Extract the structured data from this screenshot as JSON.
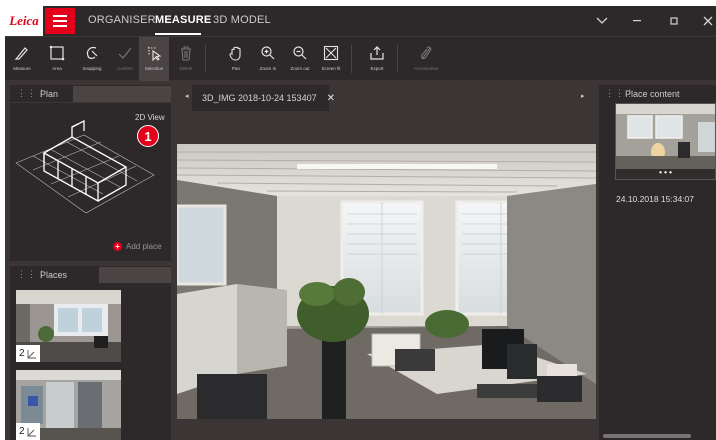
{
  "titlebar": {
    "logo_text": "Leica",
    "menu_icon": "hamburger-icon",
    "tabs": [
      {
        "label": "ORGANISER",
        "active": false
      },
      {
        "label": "MEASURE",
        "active": true
      },
      {
        "label": "3D MODEL",
        "active": false
      }
    ],
    "window_controls": [
      "chevron-down-icon",
      "minimize-icon",
      "restore-icon",
      "close-icon"
    ]
  },
  "toolbar": {
    "tools": [
      {
        "label": "Measure",
        "icon": "pencil-icon",
        "disabled": false
      },
      {
        "label": "Area",
        "icon": "square-icon",
        "disabled": false
      },
      {
        "label": "Snapping",
        "icon": "snap-icon",
        "disabled": false
      },
      {
        "label": "Confirm",
        "icon": "check-icon",
        "disabled": true
      },
      {
        "label": "Selection",
        "icon": "selection-cursor-icon",
        "disabled": false,
        "selected": true
      },
      {
        "label": "Delete",
        "icon": "trash-icon",
        "disabled": true
      },
      {
        "label": "Pan",
        "icon": "hand-icon",
        "disabled": false
      },
      {
        "label": "Zoom In",
        "icon": "zoom-in-icon",
        "disabled": false
      },
      {
        "label": "Zoom out",
        "icon": "zoom-out-icon",
        "disabled": false
      },
      {
        "label": "Screen fit",
        "icon": "screen-fit-icon",
        "disabled": false
      },
      {
        "label": "Export",
        "icon": "export-icon",
        "disabled": false
      },
      {
        "label": "Accessories",
        "icon": "accessories-icon",
        "disabled": true
      }
    ]
  },
  "plan": {
    "title": "Plan",
    "view_label": "2D View",
    "badge": "1",
    "add_place": "Add place"
  },
  "places": {
    "title": "Places",
    "items": [
      {
        "count": "2"
      },
      {
        "count": "2"
      }
    ]
  },
  "document": {
    "tab_title": "3D_IMG 2018-10-24 153407",
    "close_symbol": "✕",
    "prev_arrow": "◂",
    "next_arrow": "▸"
  },
  "place_content": {
    "title": "Place content",
    "timestamp": "24.10.2018 15:34:07",
    "more": "• • •"
  },
  "colors": {
    "accent": "#e3001b",
    "bg_dark": "#2d2829",
    "bg_mid": "#3b3536"
  }
}
